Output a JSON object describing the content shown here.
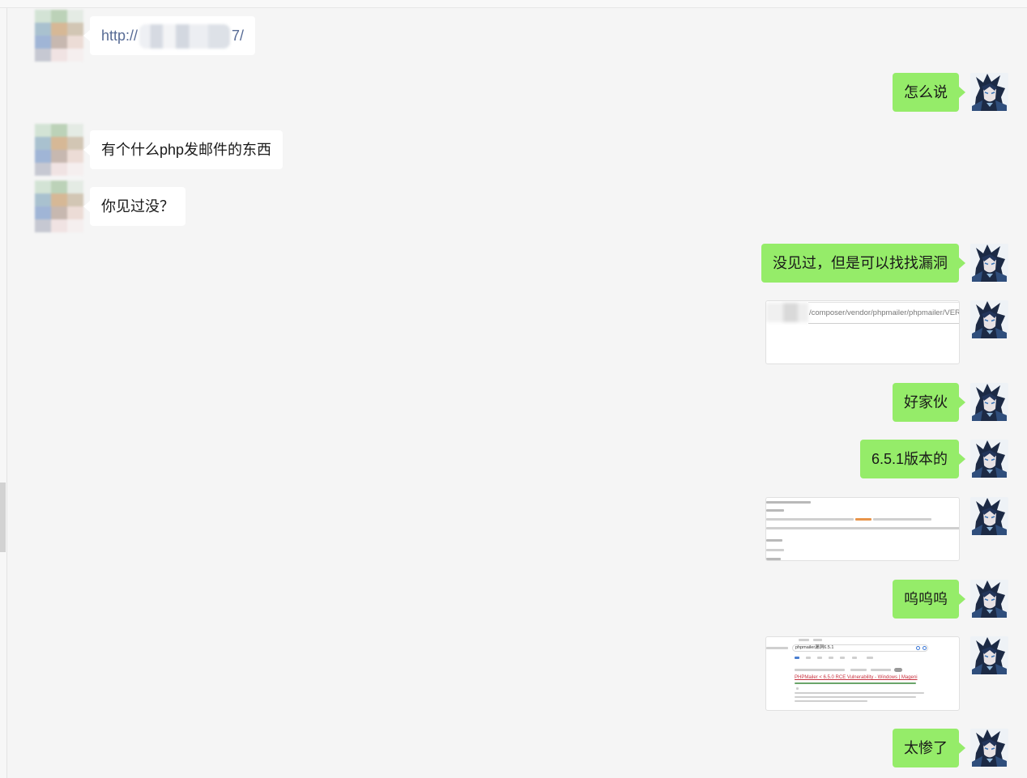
{
  "colors": {
    "outgoing_bubble": "#95ec69",
    "incoming_bubble": "#ffffff",
    "link": "#576b95",
    "background": "#f5f5f5"
  },
  "messages": [
    {
      "outgoing": false,
      "link": {
        "prefix": "http://",
        "suffix": "7/"
      }
    },
    {
      "outgoing": true,
      "text": "怎么说"
    },
    {
      "outgoing": false,
      "text": "有个什么php发邮件的东西"
    },
    {
      "outgoing": false,
      "text": "你见过没？"
    },
    {
      "outgoing": true,
      "text": "没见过，但是可以找找漏洞"
    },
    {
      "outgoing": true,
      "image": {
        "url_text": "/composer/vendor/phpmailer/phpmailer/VER"
      }
    },
    {
      "outgoing": true,
      "text": "好家伙"
    },
    {
      "outgoing": true,
      "text": "6.5.1版本的"
    },
    {
      "outgoing": true,
      "image": {}
    },
    {
      "outgoing": true,
      "text": "呜呜呜"
    },
    {
      "outgoing": true,
      "image": {
        "search_query": "phpmailer漏洞6.5.1",
        "result_title": "PHPMailer < 6.5.0 RCE Vulnerability - Windows | Mageni"
      }
    },
    {
      "outgoing": true,
      "text": "太惨了"
    }
  ]
}
